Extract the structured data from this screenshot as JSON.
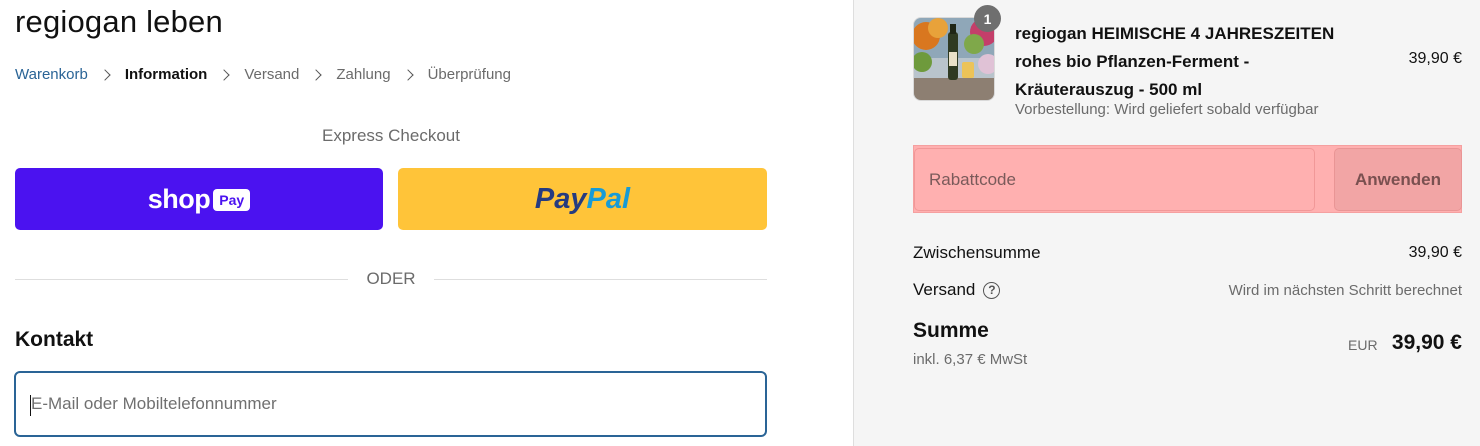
{
  "store": {
    "title": "regiogan leben"
  },
  "breadcrumb": {
    "items": [
      {
        "label": "Warenkorb"
      },
      {
        "label": "Information"
      },
      {
        "label": "Versand"
      },
      {
        "label": "Zahlung"
      },
      {
        "label": "Überprüfung"
      }
    ]
  },
  "express": {
    "label": "Express Checkout",
    "shop_pay": {
      "word": "shop",
      "pill": "Pay",
      "color": "#4b12f0"
    },
    "paypal": {
      "part1": "Pay",
      "part2": "Pal",
      "color": "#ffc439"
    }
  },
  "divider": {
    "label": "ODER"
  },
  "contact": {
    "heading": "Kontakt",
    "email_placeholder": "E-Mail oder Mobiltelefonnummer"
  },
  "cart": {
    "item": {
      "quantity": "1",
      "name": "regiogan HEIMISCHE 4 JAHRESZEITEN rohes bio Pflanzen-Ferment - Kräuterauszug - 500 ml",
      "note": "Vorbestellung: Wird geliefert sobald verfügbar",
      "price": "39,90 €"
    },
    "discount": {
      "placeholder": "Rabattcode",
      "button": "Anwenden"
    },
    "subtotal": {
      "label": "Zwischensumme",
      "value": "39,90 €"
    },
    "shipping": {
      "label": "Versand",
      "value": "Wird im nächsten Schritt berechnet"
    },
    "total": {
      "label": "Summe",
      "tax_note": "inkl. 6,37 € MwSt",
      "currency": "EUR",
      "value": "39,90 €"
    }
  }
}
